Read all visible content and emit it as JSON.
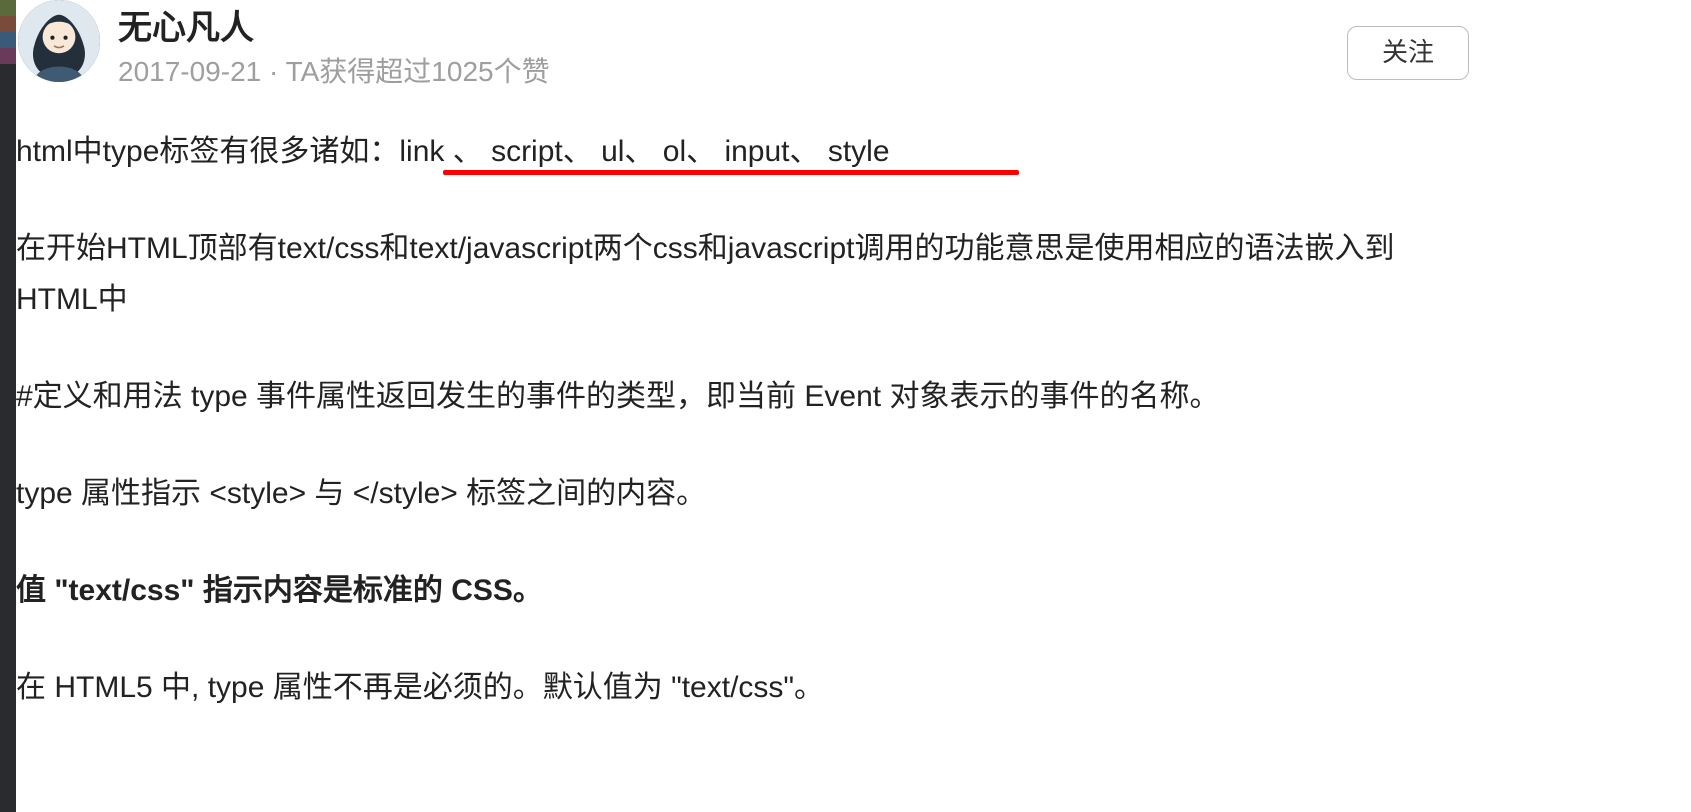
{
  "author": {
    "name": "无心凡人",
    "meta": "2017-09-21 · TA获得超过1025个赞"
  },
  "follow_button": "关注",
  "paragraphs": {
    "p1": "html中type标签有很多诸如：link 、 script、  ul、  ol、 input、 style",
    "p2": "在开始HTML顶部有text/css和text/javascript两个css和javascript调用的功能意思是使用相应的语法嵌入到HTML中",
    "p3": "#定义和用法     type 事件属性返回发生的事件的类型，即当前 Event 对象表示的事件的名称。",
    "p4": "type 属性指示 <style> 与 </style> 标签之间的内容。",
    "p5": "值 \"text/css\" 指示内容是标准的 CSS。",
    "p6": "在 HTML5 中, type 属性不再是必须的。默认值为 \"text/css\"。"
  },
  "left_strip_colors": [
    "#5a6a3a",
    "#5a6a3a",
    "#7a4a3a",
    "#7a4a3a",
    "#3a5a7a",
    "#3a5a7a",
    "#6a3a5a",
    "#6a3a5a",
    "#2a2b2e"
  ]
}
